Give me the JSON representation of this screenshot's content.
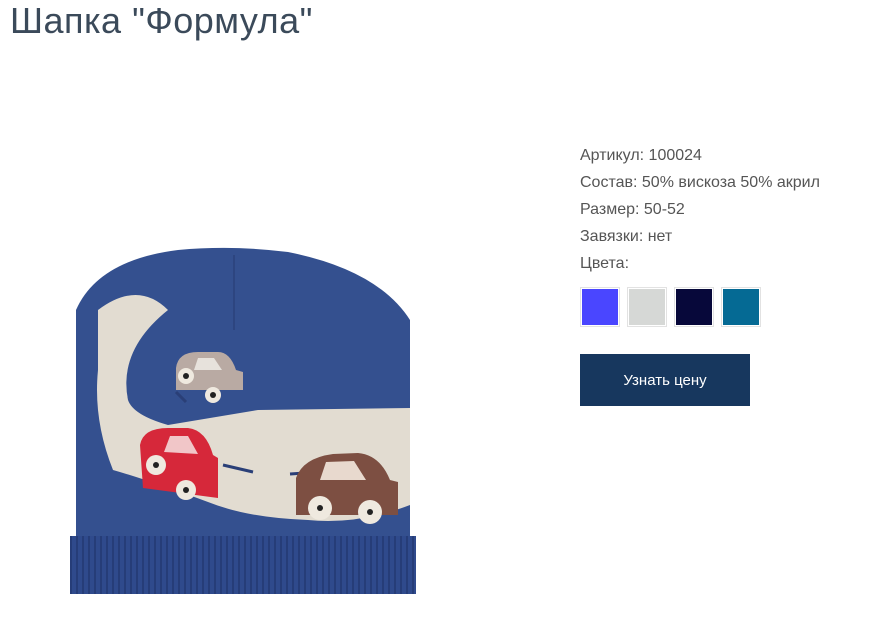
{
  "product": {
    "title": "Шапка \"Формула\"",
    "specs": {
      "article_label": "Артикул:",
      "article_value": "100024",
      "composition_label": "Состав:",
      "composition_value": "50% вискоза 50% акрил",
      "size_label": "Размер:",
      "size_value": "50-52",
      "ties_label": "Завязки:",
      "ties_value": "нет",
      "colors_label": "Цвета:"
    },
    "colors": [
      "#4a46ff",
      "#d6d8d6",
      "#07083a",
      "#056a94"
    ],
    "image_icon": "knit-hat-with-cars-image",
    "price_button_label": "Узнать цену"
  }
}
